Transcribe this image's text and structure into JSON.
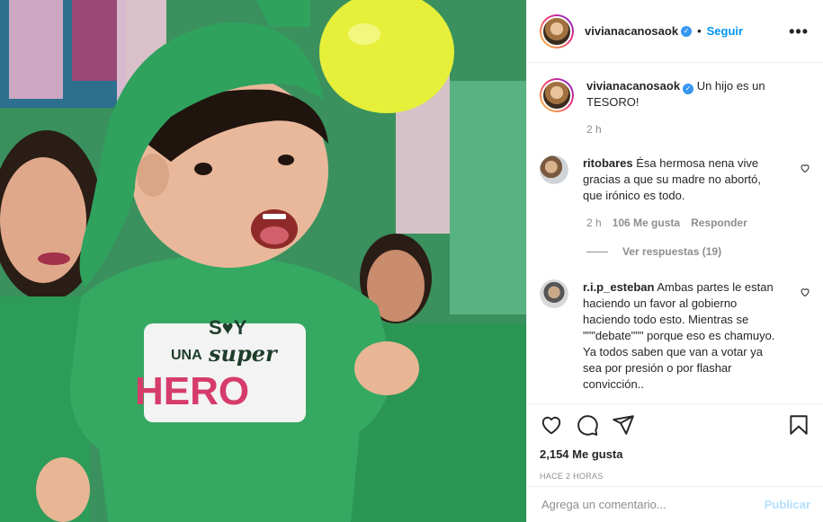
{
  "post": {
    "image_alt": "",
    "header": {
      "username": "vivianacanosaok",
      "follow_label": "Seguir",
      "more_label": "•••"
    },
    "caption": {
      "username": "vivianacanosaok",
      "text": "Un hijo es un TESORO!",
      "time": "2 h"
    },
    "comments": [
      {
        "username": "ritobares",
        "text": "Ésa hermosa nena vive gracias a que su madre no abortó, que irónico es todo.",
        "time": "2 h",
        "likes": "106 Me gusta",
        "reply_label": "Responder",
        "replies_label": "Ver respuestas (19)"
      },
      {
        "username": "r.i.p_esteban",
        "text": "Ambas partes le estan haciendo un favor al gobierno haciendo todo esto. Mientras se \"\"\"debate\"\"\" porque eso es chamuyo. Ya todos saben que van a votar ya sea por presión o por flashar convicción.."
      }
    ],
    "likes_count": "2,154 Me gusta",
    "time_ago": "HACE 2 HORAS",
    "add_comment": {
      "placeholder": "Agrega un comentario...",
      "publish_label": "Publicar"
    },
    "shirt_text": [
      "S♥Y",
      "UNA",
      "super",
      "HERO"
    ]
  },
  "colors": {
    "accent": "#0095f6",
    "verified": "#3897f0",
    "secondary_text": "#8e8e8e",
    "publish_disabled": "#b2dffc"
  }
}
